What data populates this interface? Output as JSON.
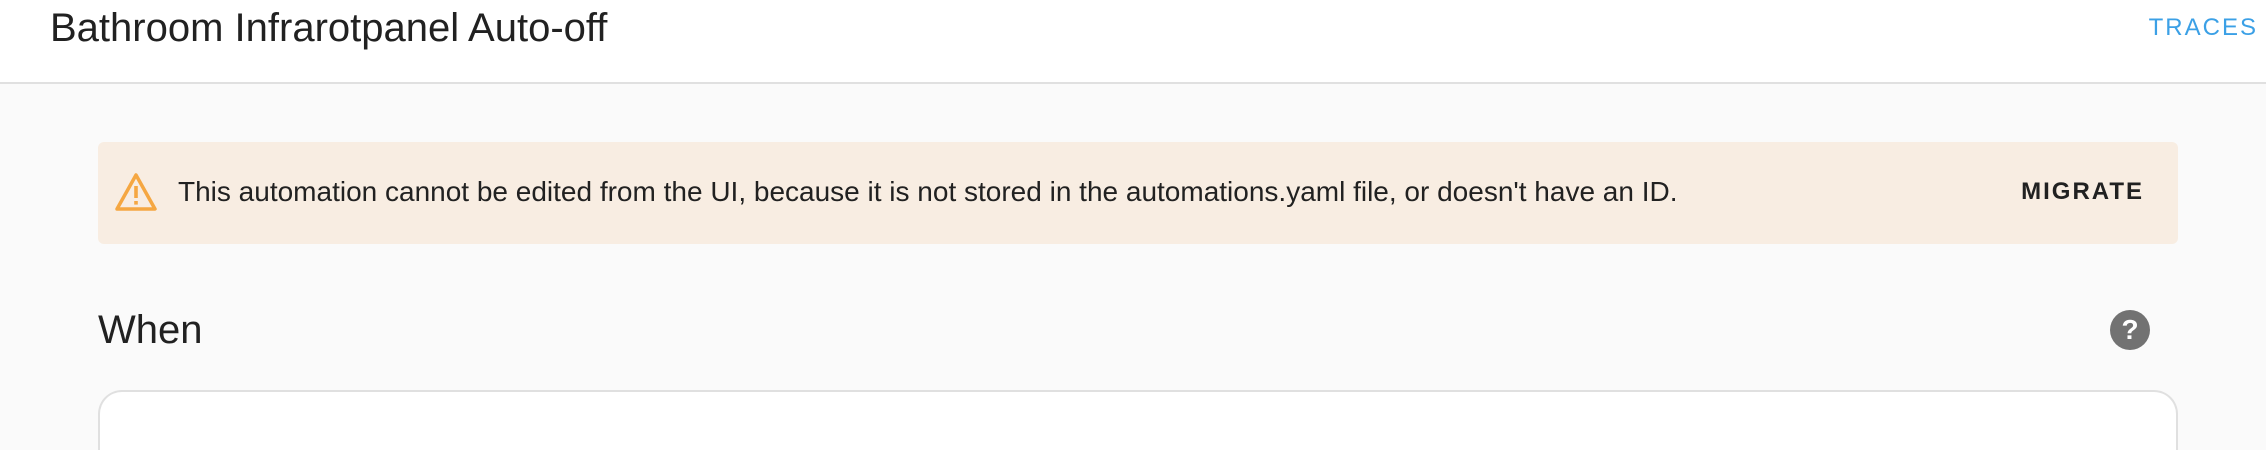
{
  "header": {
    "title": "Bathroom Infrarotpanel Auto-off",
    "traces_label": "TRACES"
  },
  "alert": {
    "icon": "warning-icon",
    "message": "This automation cannot be edited from the UI, because it is not stored in the automations.yaml file, or doesn't have an ID.",
    "action_label": "MIGRATE",
    "background_color": "#f8ede2",
    "icon_color": "#f5a742"
  },
  "section": {
    "heading": "When",
    "help_icon_glyph": "?",
    "help_icon": "help-circle-icon"
  },
  "colors": {
    "accent": "#3ba0e6",
    "page_background": "#fafafa"
  }
}
